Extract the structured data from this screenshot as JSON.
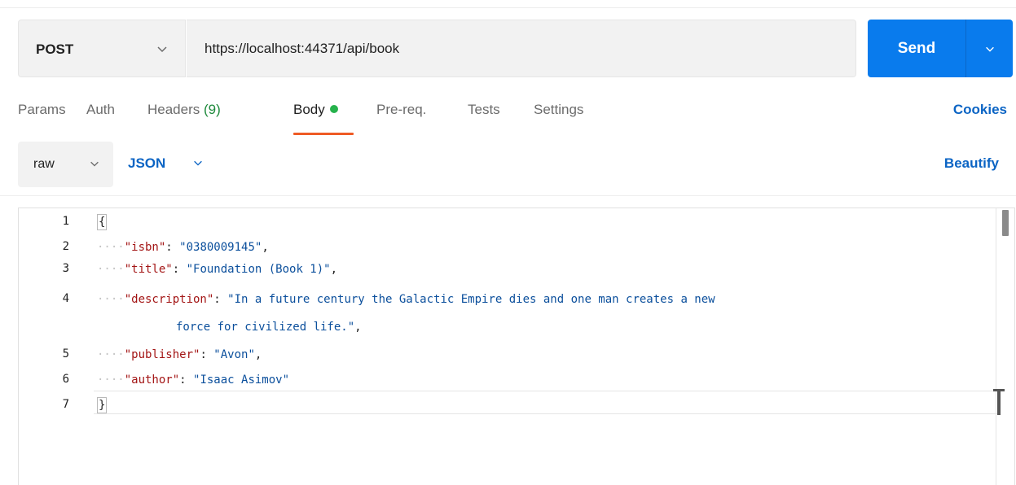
{
  "request": {
    "method": "POST",
    "url": "https://localhost:44371/api/book",
    "send_label": "Send"
  },
  "tabs": [
    {
      "label": "Params"
    },
    {
      "label": "Auth"
    },
    {
      "label": "Headers",
      "count": "(9)"
    },
    {
      "label": "Body"
    },
    {
      "label": "Pre-req."
    },
    {
      "label": "Tests"
    },
    {
      "label": "Settings"
    }
  ],
  "active_tab": "Body",
  "cookies_label": "Cookies",
  "body_type": {
    "mode": "raw",
    "format": "JSON",
    "beautify_label": "Beautify"
  },
  "editor": {
    "line_numbers": [
      "1",
      "2",
      "3",
      "4",
      "5",
      "6",
      "7"
    ],
    "lines": {
      "l1": "{",
      "l2_key": "\"isbn\"",
      "l2_val": "\"0380009145\"",
      "l3_key": "\"title\"",
      "l3_val": "\"Foundation (Book 1)\"",
      "l4_key": "\"description\"",
      "l4_val": "\"In a future century the Galactic Empire dies and one man creates a new",
      "l4_cont": "force for civilized life.\"",
      "l5_key": "\"publisher\"",
      "l5_val": "\"Avon\"",
      "l6_key": "\"author\"",
      "l6_val": "\"Isaac Asimov\"",
      "l7": "}"
    }
  },
  "colors": {
    "send": "#097bed",
    "accent_link": "#0b64c4",
    "active_tab_underline": "#ef5b25",
    "body_dot": "#26b24c",
    "json_key": "#a31515",
    "json_string": "#0b4f9c"
  }
}
